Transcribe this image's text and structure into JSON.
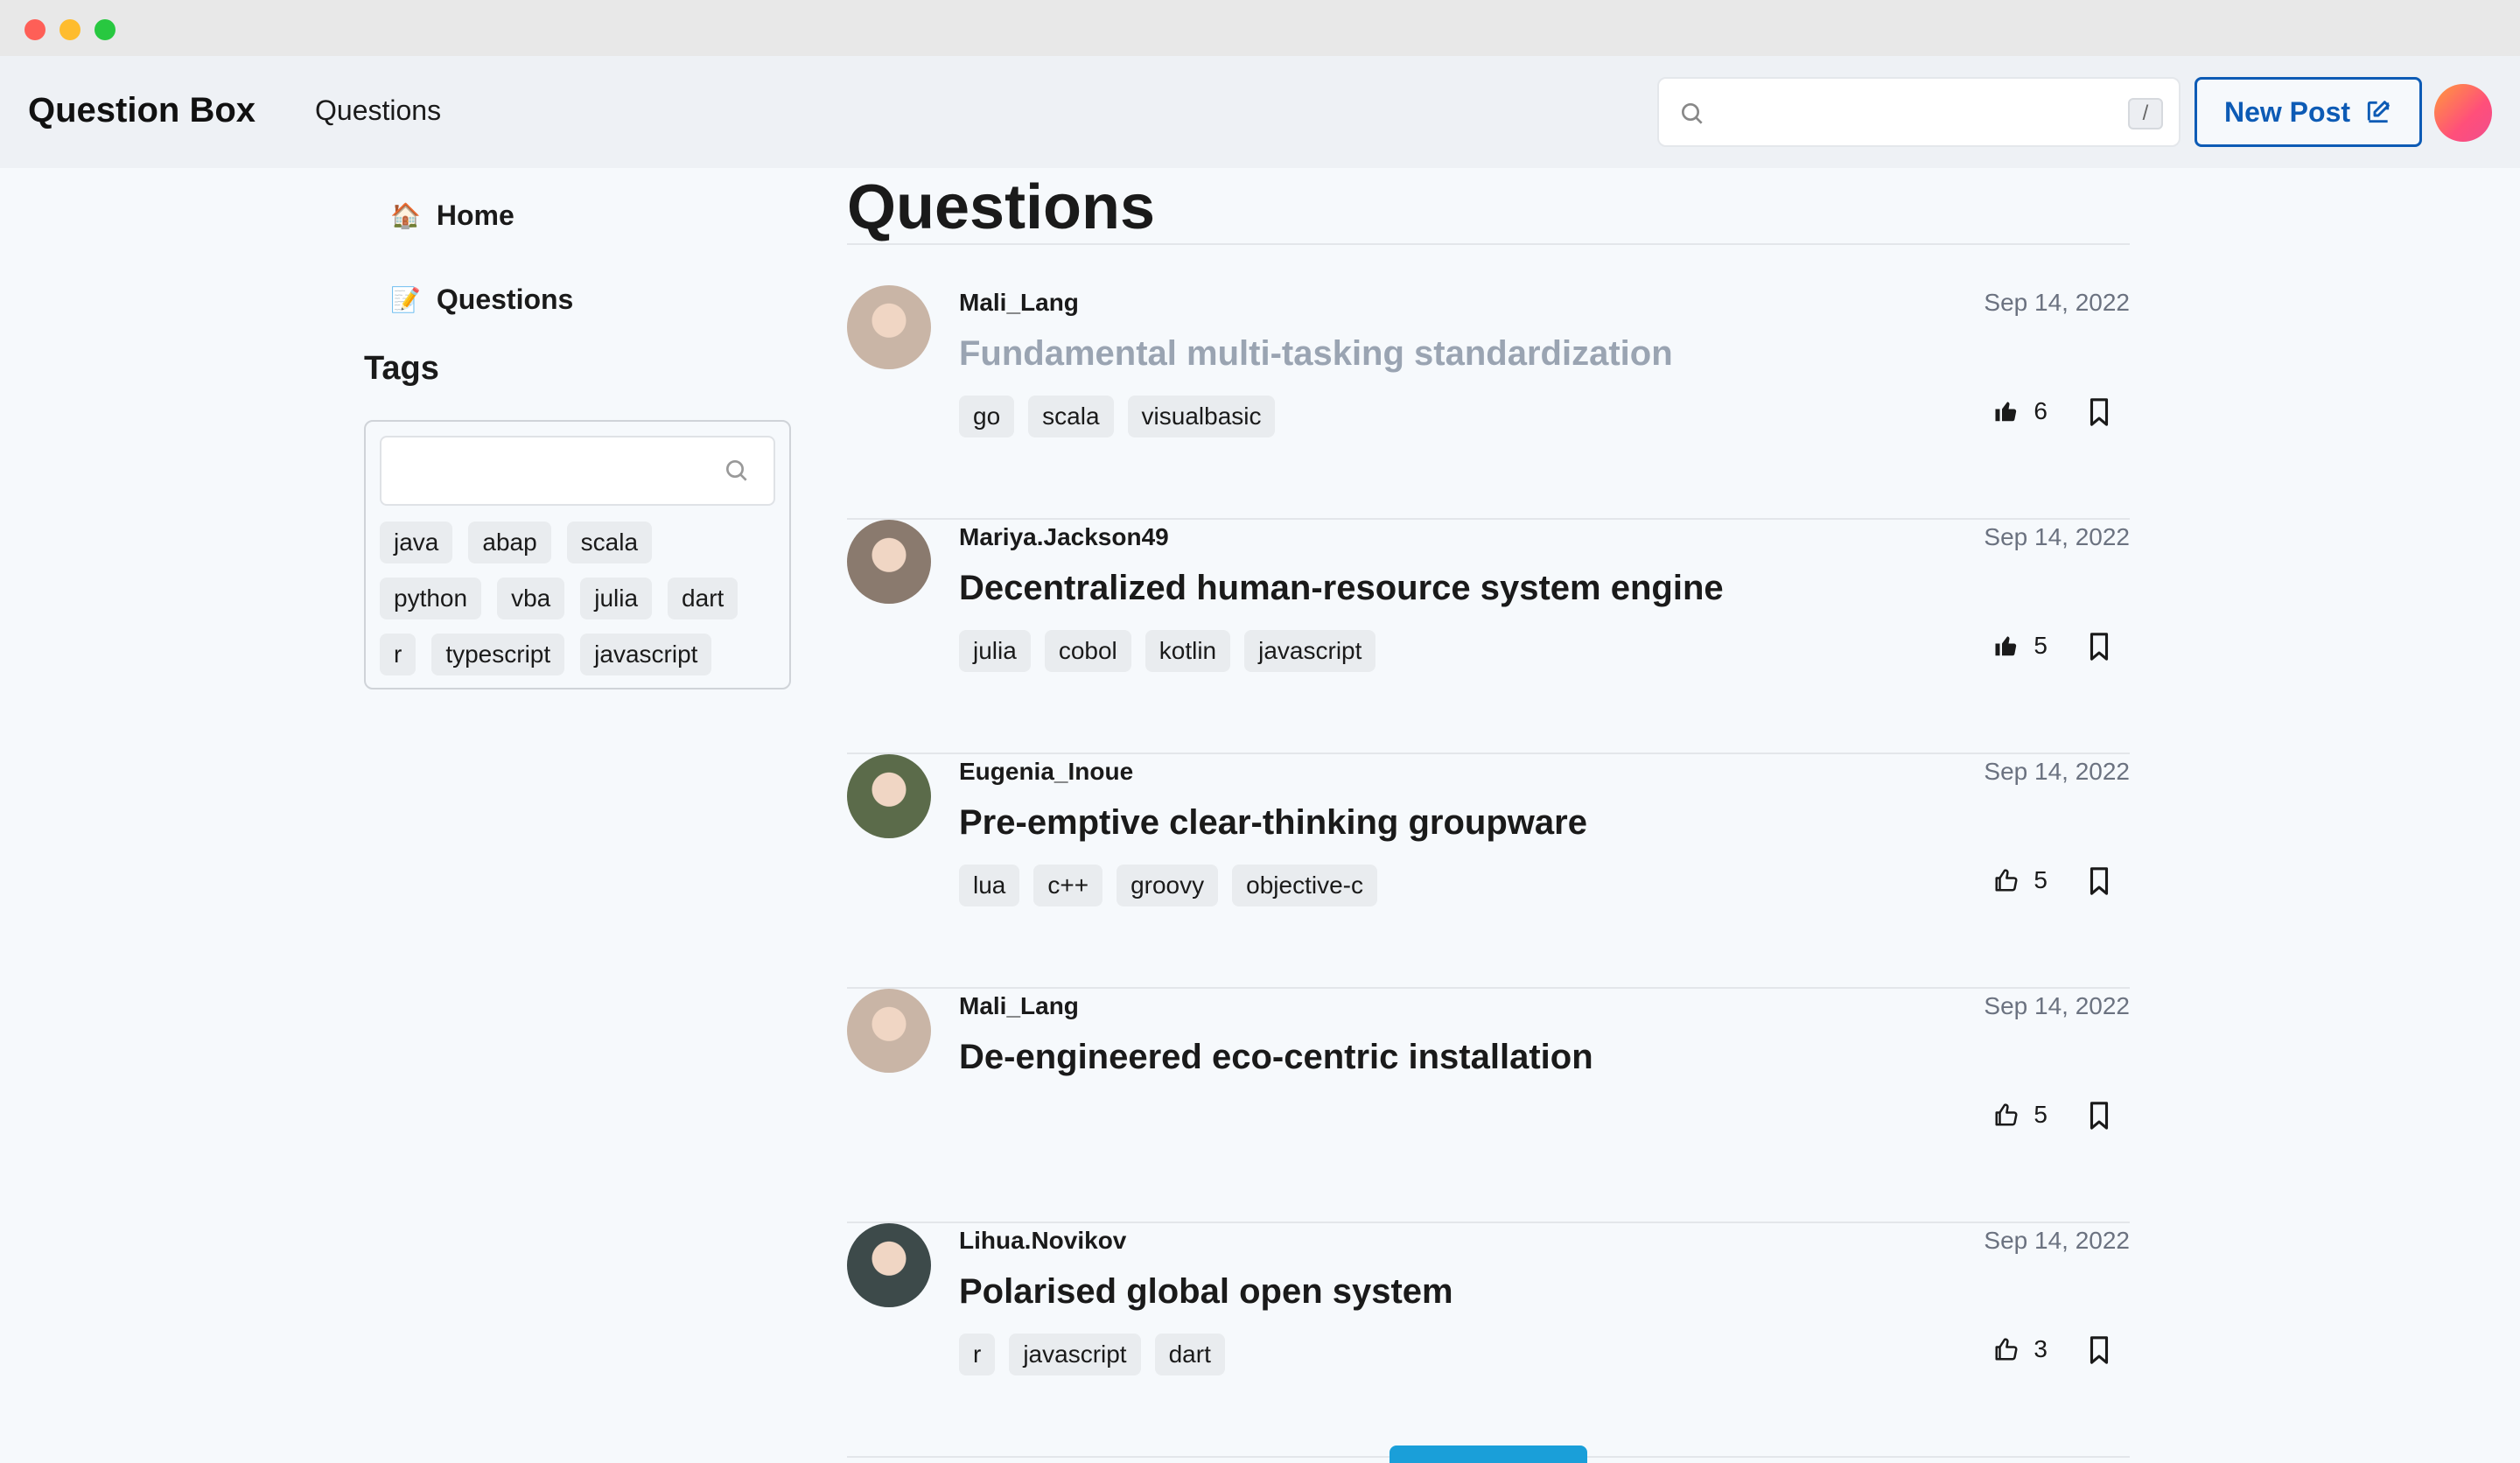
{
  "brand": "Question Box",
  "nav": {
    "questions_link": "Questions"
  },
  "search": {
    "placeholder": "",
    "shortcut": "/"
  },
  "new_post_label": "New Post",
  "sidebar": {
    "items": [
      {
        "emoji": "🏠",
        "label": "Home"
      },
      {
        "emoji": "📝",
        "label": "Questions"
      }
    ],
    "tags_title": "Tags",
    "tag_search_placeholder": "",
    "tags": [
      [
        "java",
        "abap",
        "scala"
      ],
      [
        "python",
        "vba",
        "julia",
        "dart"
      ],
      [
        "r",
        "typescript",
        "javascript"
      ]
    ]
  },
  "main": {
    "title": "Questions",
    "posts": [
      {
        "author": "Mali_Lang",
        "date": "Sep 14, 2022",
        "title": "Fundamental multi-tasking standardization",
        "tags": [
          "go",
          "scala",
          "visualbasic"
        ],
        "votes": "6",
        "voted": true,
        "avatar_color": "#c9b5a6"
      },
      {
        "author": "Mariya.Jackson49",
        "date": "Sep 14, 2022",
        "title": "Decentralized human-resource system engine",
        "tags": [
          "julia",
          "cobol",
          "kotlin",
          "javascript"
        ],
        "votes": "5",
        "voted": true,
        "avatar_color": "#8a7a6e"
      },
      {
        "author": "Eugenia_Inoue",
        "date": "Sep 14, 2022",
        "title": "Pre-emptive clear-thinking groupware",
        "tags": [
          "lua",
          "c++",
          "groovy",
          "objective-c"
        ],
        "votes": "5",
        "voted": false,
        "avatar_color": "#5b6b4a"
      },
      {
        "author": "Mali_Lang",
        "date": "Sep 14, 2022",
        "title": "De-engineered eco-centric installation",
        "tags": [],
        "votes": "5",
        "voted": false,
        "avatar_color": "#c9b5a6"
      },
      {
        "author": "Lihua.Novikov",
        "date": "Sep 14, 2022",
        "title": "Polarised global open system",
        "tags": [
          "r",
          "javascript",
          "dart"
        ],
        "votes": "3",
        "voted": false,
        "avatar_color": "#3d4a4a"
      }
    ]
  }
}
